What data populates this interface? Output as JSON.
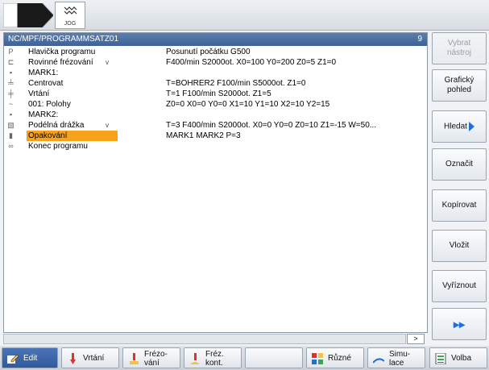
{
  "topbar": {
    "jog_label": "JOG"
  },
  "program": {
    "path": "NC/MPF/PROGRAMMSATZ01",
    "count": "9",
    "rows": [
      {
        "icon": "P",
        "name": "Hlavička programu",
        "arrow": "",
        "params": "Posunutí počátku G500"
      },
      {
        "icon": "⊏",
        "name": "Rovinné frézování",
        "arrow": "v",
        "params": "F400/min S2000ot. X0=100 Y0=200 Z0=5 Z1=0"
      },
      {
        "icon": "▪",
        "name": "MARK1:",
        "arrow": "",
        "params": ""
      },
      {
        "icon": "╧",
        "name": "Centrovat",
        "arrow": "",
        "params": "T=BOHRER2 F100/min S5000ot. Z1=0"
      },
      {
        "icon": "╪",
        "name": "Vrtání",
        "arrow": "",
        "params": "T=1 F100/min S2000ot. Z1=5"
      },
      {
        "icon": "~",
        "name": "001: Polohy",
        "arrow": "",
        "params": "Z0=0 X0=0 Y0=0 X1=10 Y1=10 X2=10 Y2=15"
      },
      {
        "icon": "▪",
        "name": "MARK2:",
        "arrow": "",
        "params": ""
      },
      {
        "icon": "▧",
        "name": "Podélná drážka",
        "arrow": "v",
        "params": "T=3 F400/min S2000ot. X0=0 Y0=0 Z0=10 Z1=-15 W=50..."
      },
      {
        "icon": "▮",
        "name": "Opakování",
        "arrow": "",
        "params": "MARK1 MARK2 P=3"
      },
      {
        "icon": "∞",
        "name": "Konec programu",
        "arrow": "",
        "params": ""
      }
    ],
    "scroll_indicator": ">"
  },
  "softkeys_right": [
    {
      "label_1": "Vybrat",
      "label_2": "nástroj"
    },
    {
      "label_1": "Grafický",
      "label_2": "pohled"
    },
    {
      "label_1": "Hledat",
      "label_2": ""
    },
    {
      "label_1": "Označit",
      "label_2": ""
    },
    {
      "label_1": "Kopírovat",
      "label_2": ""
    },
    {
      "label_1": "Vložit",
      "label_2": ""
    },
    {
      "label_1": "Vyříznout",
      "label_2": ""
    },
    {
      "label_1": "▸▸",
      "label_2": ""
    }
  ],
  "softkeys_bottom": [
    {
      "label_1": "Edit",
      "label_2": ""
    },
    {
      "label_1": "Vrtání",
      "label_2": ""
    },
    {
      "label_1": "Frézo-",
      "label_2": "vání"
    },
    {
      "label_1": "Fréz.",
      "label_2": "kont."
    },
    {
      "label_1": "",
      "label_2": ""
    },
    {
      "label_1": "Různé",
      "label_2": ""
    },
    {
      "label_1": "Simu-",
      "label_2": "lace"
    },
    {
      "label_1": "Volba",
      "label_2": ""
    }
  ],
  "colors": {
    "header": "#4a6da3",
    "selection": "#f6a21a",
    "accent": "#1f6fd6"
  }
}
